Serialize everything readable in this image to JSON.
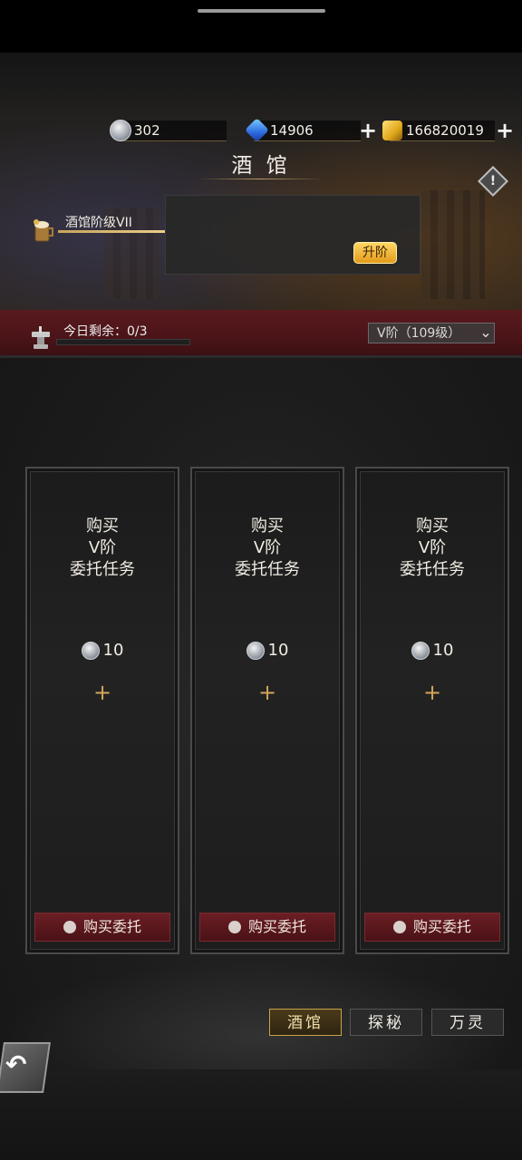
{
  "currencies": {
    "silver": "302",
    "gems": "14906",
    "gold": "166820019"
  },
  "header": {
    "title": "酒 馆"
  },
  "tavern": {
    "level_label": "酒馆阶级VII",
    "upgrade_button": "升阶"
  },
  "daily": {
    "remaining_label": "今日剩余：0/3",
    "remaining_progress": 0
  },
  "tier_select": {
    "value": "V阶（109级）"
  },
  "cards": [
    {
      "line1": "购买",
      "line2": "V阶",
      "line3": "委托任务",
      "cost": "10",
      "button": "购买委托"
    },
    {
      "line1": "购买",
      "line2": "V阶",
      "line3": "委托任务",
      "cost": "10",
      "button": "购买委托"
    },
    {
      "line1": "购买",
      "line2": "V阶",
      "line3": "委托任务",
      "cost": "10",
      "button": "购买委托"
    }
  ],
  "tabs": [
    "酒馆",
    "探秘",
    "万灵"
  ],
  "active_tab": "酒馆",
  "icons": {
    "silver": "silver-coin-icon",
    "gem": "blue-gem-icon",
    "gold": "gold-coin-icon",
    "info": "info-diamond-icon",
    "tavern": "tavern-mug-icon",
    "anvil": "anvil-icon",
    "chevron": "chevron-down-icon",
    "lock": "lock-icon",
    "back": "back-arrow-icon"
  },
  "colors": {
    "accent_gold": "#d4a55a",
    "red_band": "#4a1418",
    "upgrade_button": "#ffd765"
  }
}
